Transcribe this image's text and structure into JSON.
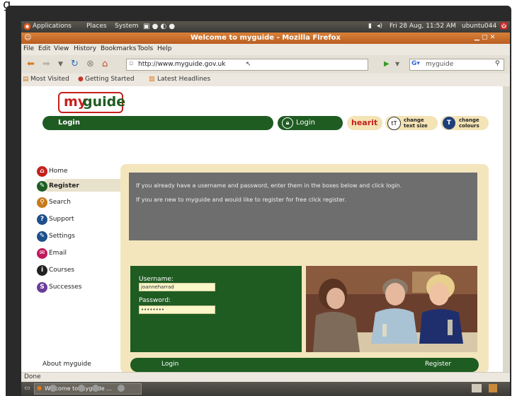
{
  "header_text": "g",
  "os_panel": {
    "applications": "Applications",
    "places": "Places",
    "system": "System",
    "datetime": "Fri 28 Aug, 11:52 AM",
    "username": "ubuntu044"
  },
  "window": {
    "title": "Welcome to myguide - Mozilla Firefox"
  },
  "menu": [
    "File",
    "Edit",
    "View",
    "History",
    "Bookmarks",
    "Tools",
    "Help"
  ],
  "navigation": {
    "url": "http://www.myguide.gov.uk",
    "search_value": "myguide"
  },
  "bookmarks": [
    "Most Visited",
    "Getting Started",
    "Latest Headlines"
  ],
  "site": {
    "logo": {
      "part1": "my",
      "part2": "guide"
    },
    "header_bar_label": "Login",
    "login_button": "Login",
    "hearit": "hearit",
    "change_text_size": "change text size",
    "change_colours": "change colours",
    "sidebar": [
      {
        "label": "Home",
        "icon": "home-icon",
        "color": "#c4201d",
        "glyph": "⌂"
      },
      {
        "label": "Register",
        "icon": "register-icon",
        "color": "#1f5c22",
        "glyph": "✎"
      },
      {
        "label": "Search",
        "icon": "search-icon",
        "color": "#c77a1a",
        "glyph": "⚲"
      },
      {
        "label": "Support",
        "icon": "support-icon",
        "color": "#1d4f8a",
        "glyph": "?"
      },
      {
        "label": "Settings",
        "icon": "settings-icon",
        "color": "#1d4f8a",
        "glyph": "✎"
      },
      {
        "label": "Email",
        "icon": "email-icon",
        "color": "#c2185b",
        "glyph": "✉"
      },
      {
        "label": "Courses",
        "icon": "courses-icon",
        "color": "#222222",
        "glyph": "i"
      },
      {
        "label": "Successes",
        "icon": "successes-icon",
        "color": "#6a3d9a",
        "glyph": "S"
      }
    ],
    "about": "About myguide",
    "info_line1": "If you already have a username and password, enter them in the boxes below and click login.",
    "info_line2": "If you are new to myguide and would like to register for free click register.",
    "username_label": "Username:",
    "username_value": "joanneharrad",
    "password_label": "Password:",
    "password_value": "••••••••",
    "footer_login": "Login",
    "footer_register": "Register"
  },
  "status": "Done",
  "taskbar_item": "Welcome to myguide ..."
}
